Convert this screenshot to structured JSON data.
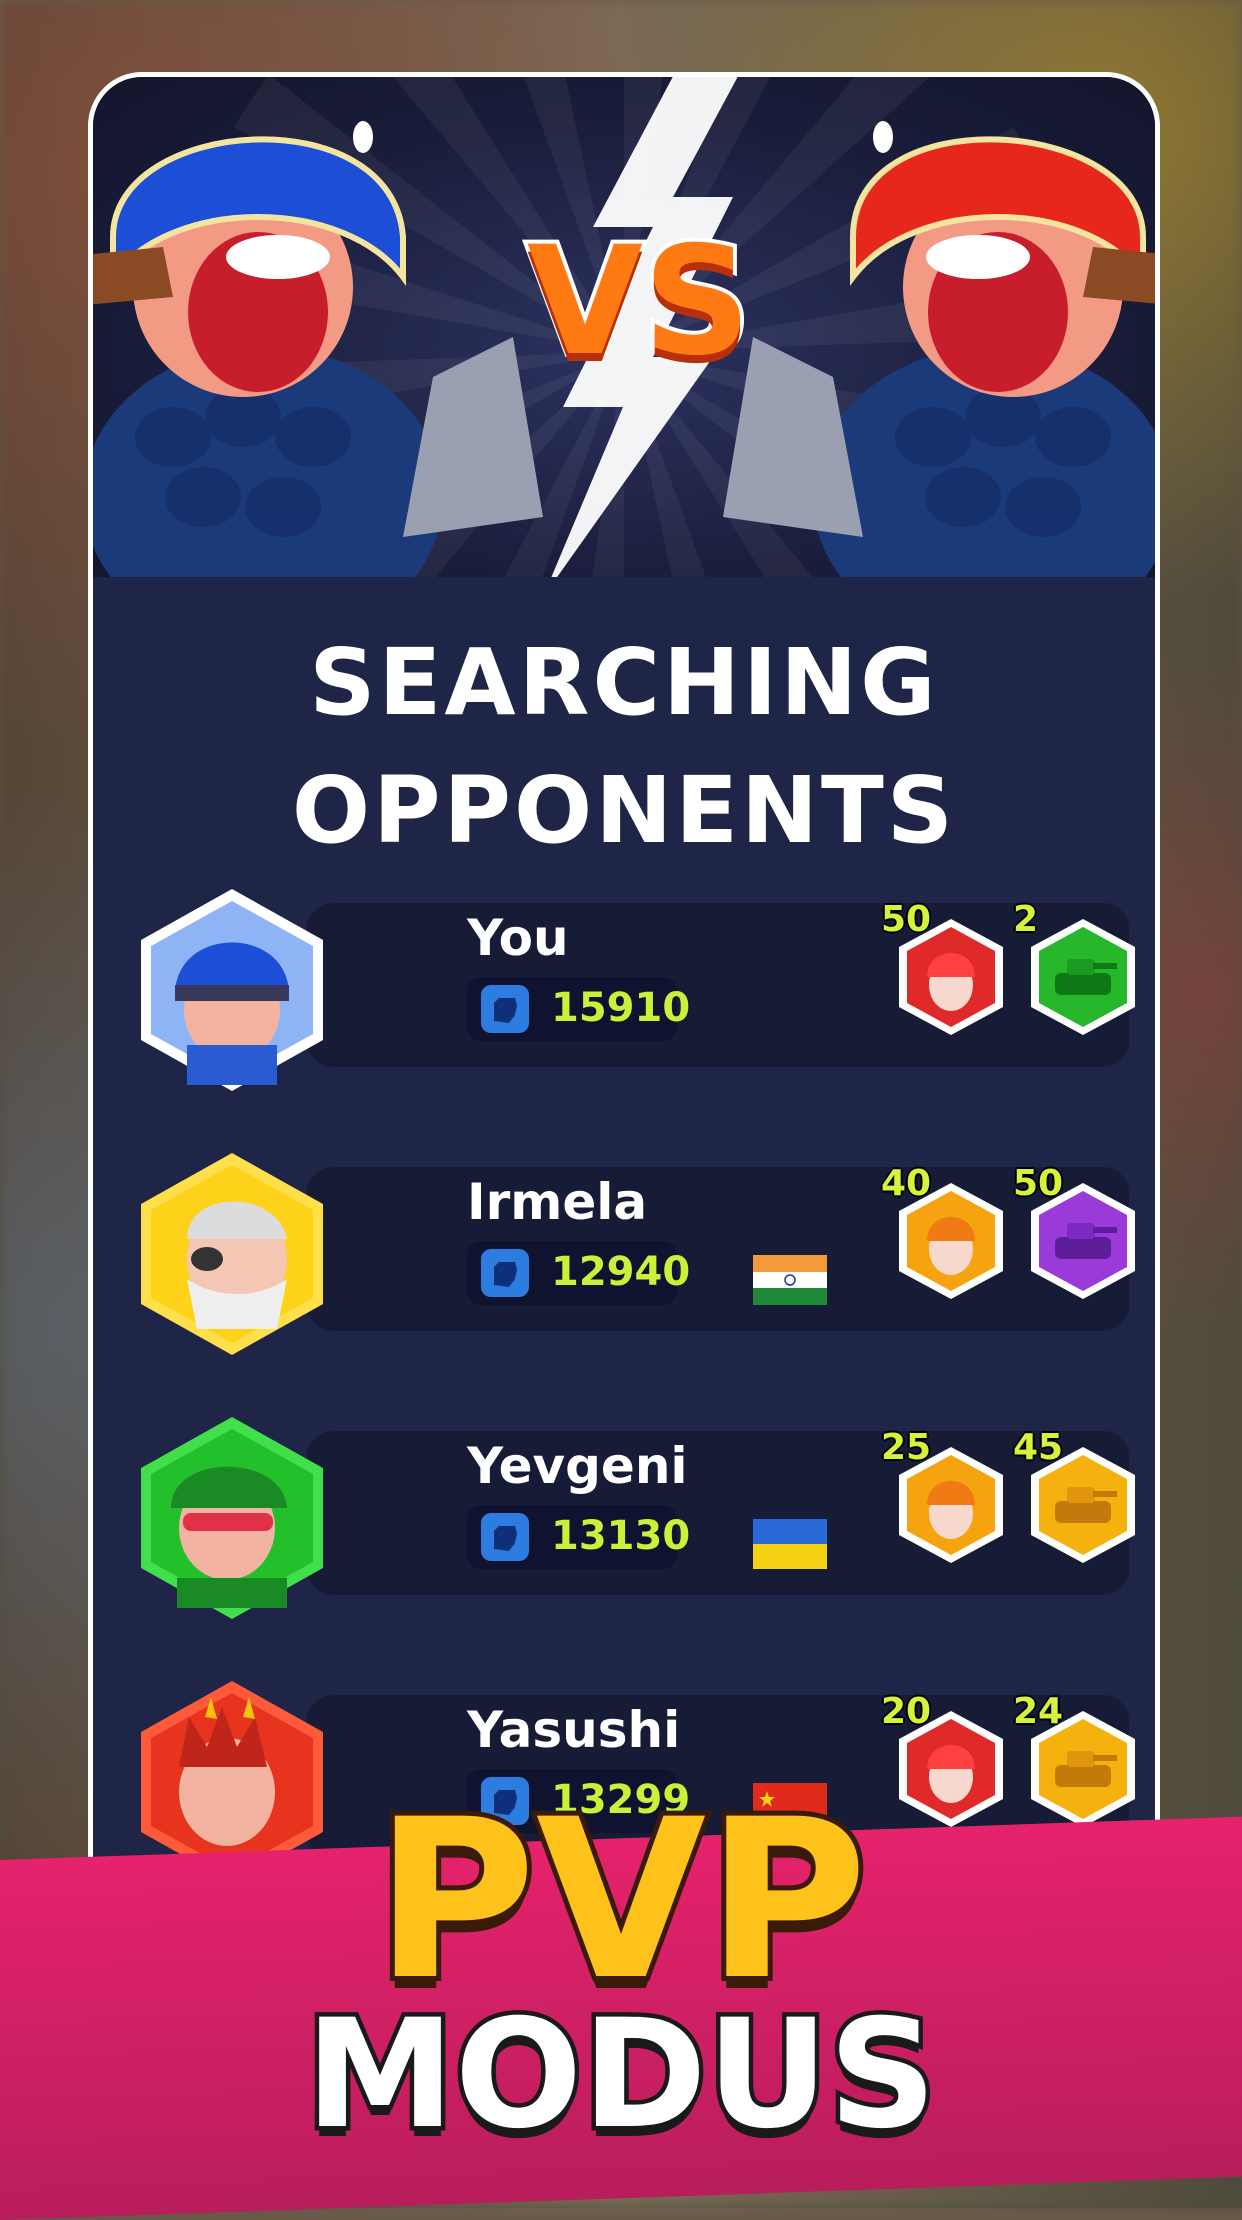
{
  "header": {
    "vs_label": "VS",
    "title_line1": "SEARCHING",
    "title_line2": "OPPONENTS"
  },
  "players": [
    {
      "name": "You",
      "score": "15910",
      "flag": "",
      "badge1": {
        "count": "50",
        "type": "infantry",
        "color": "red"
      },
      "badge2": {
        "count": "2",
        "type": "tank",
        "color": "green"
      },
      "avatar_color": "blue"
    },
    {
      "name": "Irmela",
      "score": "12940",
      "flag": "india",
      "badge1": {
        "count": "40",
        "type": "infantry",
        "color": "orange"
      },
      "badge2": {
        "count": "50",
        "type": "tank",
        "color": "purple"
      },
      "avatar_color": "yellow"
    },
    {
      "name": "Yevgeni",
      "score": "13130",
      "flag": "ukraine",
      "badge1": {
        "count": "25",
        "type": "infantry",
        "color": "orange"
      },
      "badge2": {
        "count": "45",
        "type": "tank",
        "color": "orange"
      },
      "avatar_color": "green"
    },
    {
      "name": "Yasushi",
      "score": "13299",
      "flag": "china",
      "badge1": {
        "count": "20",
        "type": "infantry",
        "color": "red"
      },
      "badge2": {
        "count": "24",
        "type": "tank",
        "color": "orange"
      },
      "avatar_color": "red"
    }
  ],
  "promo": {
    "line1": "PVP",
    "line2": "MODUS"
  },
  "colors": {
    "panel": "#1e2547",
    "row": "#161b36",
    "score": "#c8f23a",
    "pink": "#e6226c"
  }
}
